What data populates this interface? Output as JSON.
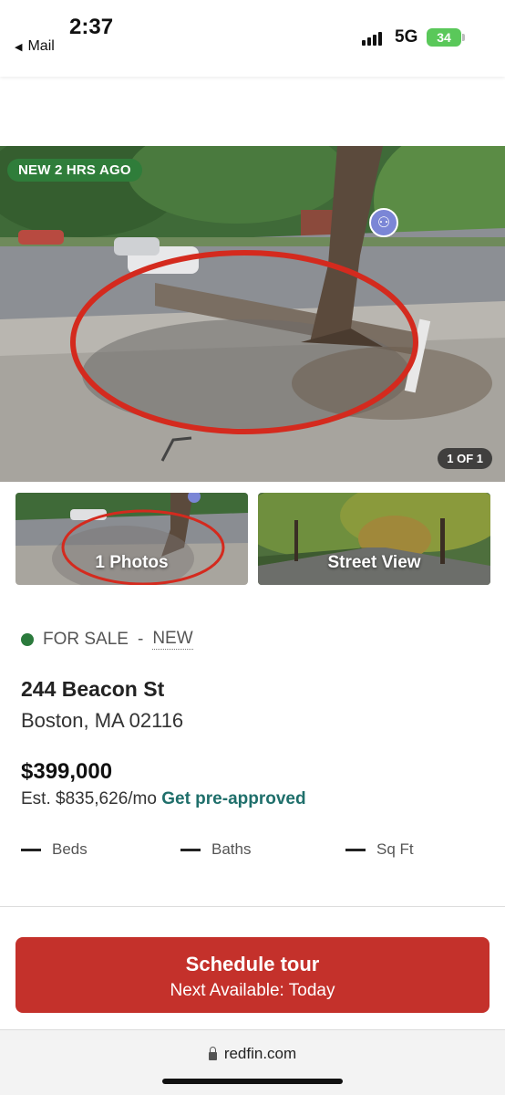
{
  "status_bar": {
    "time": "2:37",
    "back_app": "Mail",
    "network": "5G",
    "battery": "34"
  },
  "hero": {
    "badge": "NEW 2 HRS AGO",
    "counter": "1 OF 1"
  },
  "thumbnails": {
    "photos_label": "1 Photos",
    "street_view_label": "Street View"
  },
  "listing": {
    "status_prefix": "FOR SALE",
    "status_separator": "-",
    "status_new": "NEW",
    "status_color": "#2b7a3c",
    "street": "244 Beacon St",
    "city": "Boston, MA 02116",
    "price": "$399,000",
    "est_payment": "Est. $835,626/mo",
    "pre_approved": "Get pre-approved",
    "stats": {
      "beds": {
        "value": "—",
        "label": "Beds"
      },
      "baths": {
        "value": "—",
        "label": "Baths"
      },
      "sqft": {
        "value": "—",
        "label": "Sq Ft"
      }
    }
  },
  "cta": {
    "title": "Schedule tour",
    "subtitle": "Next Available: Today",
    "color": "#c4312b"
  },
  "browser": {
    "url": "redfin.com"
  }
}
